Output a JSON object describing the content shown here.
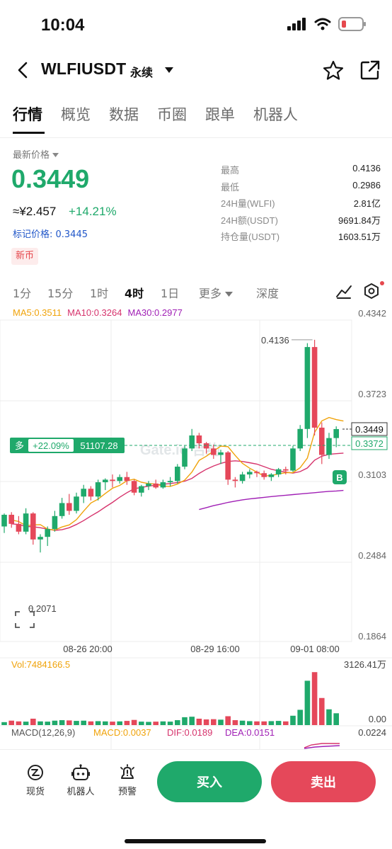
{
  "status": {
    "time": "10:04"
  },
  "header": {
    "symbol": "WLFIUSDT",
    "contract_type": "永续"
  },
  "tabs": [
    {
      "label": "行情",
      "active": true
    },
    {
      "label": "概览"
    },
    {
      "label": "数据"
    },
    {
      "label": "币圈"
    },
    {
      "label": "跟单"
    },
    {
      "label": "机器人"
    }
  ],
  "ticker": {
    "price_label": "最新价格",
    "last_price": "0.3449",
    "cny_price": "≈¥2.457",
    "change_pct": "+14.21%",
    "mark_price": "标记价格: 0.3445",
    "badge": "新币"
  },
  "stats": [
    {
      "label": "最高",
      "value": "0.4136"
    },
    {
      "label": "最低",
      "value": "0.2986"
    },
    {
      "label": "24H量(WLFI)",
      "value": "2.81亿"
    },
    {
      "label": "24H额(USDT)",
      "value": "9691.84万"
    },
    {
      "label": "持仓量(USDT)",
      "value": "1603.51万"
    }
  ],
  "timeframes": [
    {
      "label": "1分"
    },
    {
      "label": "15分"
    },
    {
      "label": "1时"
    },
    {
      "label": "4时",
      "active": true
    },
    {
      "label": "1日"
    },
    {
      "label": "更多"
    },
    {
      "label": "深度"
    }
  ],
  "ma_legend": {
    "ma5": "MA5:0.3511",
    "ma10": "MA10:0.3264",
    "ma30": "MA30:0.2977"
  },
  "colors": {
    "up": "#1fa96b",
    "down": "#e5485a",
    "ma5": "#f0a30a",
    "ma10": "#d6336c",
    "ma30": "#a01fb5",
    "accent_blue": "#2157c9"
  },
  "chart_data": {
    "type": "candlestick",
    "price_axis_labels": [
      "0.4342",
      "0.3723",
      "0.3103",
      "0.2484",
      "0.1864"
    ],
    "ylim": [
      0.1864,
      0.4342
    ],
    "x_tick_labels": [
      "08-26 20:00",
      "08-29 16:00",
      "09-01 08:00"
    ],
    "high_marker": "0.4136",
    "low_marker": "0.2071",
    "last_price_tag": "0.3449",
    "mark_price_tag": "0.3372",
    "position_tag": {
      "side": "多",
      "pnl": "+22.09%",
      "size": "51107.28"
    },
    "buy_marker": "B",
    "watermark": "Gate.io 合约",
    "candles": [
      [
        0.27,
        0.28,
        0.265,
        0.279
      ],
      [
        0.279,
        0.281,
        0.269,
        0.272
      ],
      [
        0.272,
        0.278,
        0.264,
        0.266
      ],
      [
        0.266,
        0.284,
        0.264,
        0.28
      ],
      [
        0.28,
        0.281,
        0.256,
        0.26
      ],
      [
        0.26,
        0.264,
        0.25,
        0.262
      ],
      [
        0.262,
        0.27,
        0.255,
        0.268
      ],
      [
        0.268,
        0.282,
        0.266,
        0.278
      ],
      [
        0.278,
        0.292,
        0.276,
        0.288
      ],
      [
        0.288,
        0.295,
        0.279,
        0.282
      ],
      [
        0.282,
        0.296,
        0.28,
        0.293
      ],
      [
        0.293,
        0.302,
        0.288,
        0.299
      ],
      [
        0.299,
        0.301,
        0.29,
        0.293
      ],
      [
        0.293,
        0.306,
        0.29,
        0.304
      ],
      [
        0.304,
        0.307,
        0.298,
        0.306
      ],
      [
        0.306,
        0.31,
        0.3,
        0.305
      ],
      [
        0.305,
        0.31,
        0.303,
        0.308
      ],
      [
        0.308,
        0.312,
        0.302,
        0.305
      ],
      [
        0.305,
        0.306,
        0.294,
        0.296
      ],
      [
        0.296,
        0.302,
        0.293,
        0.301
      ],
      [
        0.301,
        0.305,
        0.298,
        0.303
      ],
      [
        0.303,
        0.306,
        0.299,
        0.3
      ],
      [
        0.3,
        0.306,
        0.299,
        0.304
      ],
      [
        0.304,
        0.308,
        0.301,
        0.305
      ],
      [
        0.305,
        0.318,
        0.303,
        0.316
      ],
      [
        0.316,
        0.332,
        0.314,
        0.33
      ],
      [
        0.33,
        0.345,
        0.328,
        0.34
      ],
      [
        0.34,
        0.342,
        0.33,
        0.334
      ],
      [
        0.334,
        0.335,
        0.326,
        0.33
      ],
      [
        0.33,
        0.333,
        0.322,
        0.325
      ],
      [
        0.325,
        0.329,
        0.318,
        0.327
      ],
      [
        0.327,
        0.328,
        0.302,
        0.306
      ],
      [
        0.306,
        0.308,
        0.3,
        0.305
      ],
      [
        0.305,
        0.312,
        0.303,
        0.31
      ],
      [
        0.31,
        0.314,
        0.307,
        0.312
      ],
      [
        0.312,
        0.313,
        0.308,
        0.311
      ],
      [
        0.311,
        0.313,
        0.306,
        0.308
      ],
      [
        0.308,
        0.311,
        0.305,
        0.31
      ],
      [
        0.31,
        0.315,
        0.308,
        0.314
      ],
      [
        0.314,
        0.316,
        0.31,
        0.313
      ],
      [
        0.313,
        0.332,
        0.312,
        0.33
      ],
      [
        0.33,
        0.348,
        0.328,
        0.345
      ],
      [
        0.345,
        0.411,
        0.338,
        0.408
      ],
      [
        0.408,
        0.4136,
        0.34,
        0.346
      ],
      [
        0.346,
        0.35,
        0.318,
        0.325
      ],
      [
        0.325,
        0.342,
        0.322,
        0.338
      ],
      [
        0.338,
        0.347,
        0.331,
        0.3449
      ]
    ],
    "ma5": [
      0.275,
      0.2738,
      0.2706,
      0.2712,
      0.2714,
      0.268,
      0.2672,
      0.2696,
      0.2712,
      0.2752,
      0.2818,
      0.288,
      0.291,
      0.2954,
      0.2994,
      0.3016,
      0.3052,
      0.3064,
      0.304,
      0.303,
      0.3026,
      0.301,
      0.3008,
      0.3026,
      0.3056,
      0.3118,
      0.3208,
      0.324,
      0.328,
      0.3318,
      0.3314,
      0.3246,
      0.3186,
      0.3148,
      0.3118,
      0.3088,
      0.3092,
      0.3104,
      0.3114,
      0.3114,
      0.3152,
      0.3226,
      0.3424,
      0.3512,
      0.3538,
      0.3522,
      0.3511
    ],
    "ma10": [
      0.272,
      0.2715,
      0.27,
      0.2698,
      0.269,
      0.268,
      0.267,
      0.2675,
      0.269,
      0.2715,
      0.2745,
      0.278,
      0.2812,
      0.285,
      0.2885,
      0.2925,
      0.296,
      0.299,
      0.3,
      0.301,
      0.3018,
      0.3025,
      0.303,
      0.3038,
      0.3048,
      0.307,
      0.3108,
      0.314,
      0.3165,
      0.3185,
      0.32,
      0.3205,
      0.32,
      0.319,
      0.318,
      0.316,
      0.314,
      0.3128,
      0.3118,
      0.311,
      0.3122,
      0.315,
      0.321,
      0.324,
      0.3255,
      0.326,
      0.3264
    ],
    "ma30": [
      null,
      null,
      null,
      null,
      null,
      null,
      null,
      null,
      null,
      null,
      null,
      null,
      null,
      null,
      null,
      null,
      null,
      null,
      null,
      null,
      null,
      null,
      null,
      null,
      null,
      null,
      0.283,
      0.2845,
      0.286,
      0.2872,
      0.2885,
      0.2895,
      0.2905,
      0.2912,
      0.2918,
      0.2924,
      0.293,
      0.2935,
      0.294,
      0.2945,
      0.295,
      0.2955,
      0.296,
      0.2965,
      0.297,
      0.2973,
      0.2977
    ],
    "volume_label": "Vol:7484166.5",
    "volume_axis_max": "3126.41万",
    "volume_axis_min": "0.00",
    "volume": [
      120,
      180,
      150,
      140,
      260,
      150,
      140,
      180,
      200,
      190,
      170,
      180,
      150,
      160,
      150,
      140,
      150,
      170,
      210,
      140,
      130,
      140,
      150,
      140,
      200,
      320,
      340,
      260,
      230,
      240,
      220,
      360,
      200,
      180,
      160,
      150,
      150,
      160,
      170,
      150,
      380,
      620,
      1800,
      2150,
      1100,
      640,
      480
    ],
    "macd_legend": {
      "title": "MACD(12,26,9)",
      "macd": "MACD:0.0037",
      "dif": "DIF:0.0189",
      "dea": "DEA:0.0151"
    },
    "macd_axis": "0.0224"
  },
  "bottom_nav": [
    {
      "label": "现货",
      "icon": "spot-icon"
    },
    {
      "label": "机器人",
      "icon": "robot-icon"
    },
    {
      "label": "预警",
      "icon": "alert-icon"
    }
  ],
  "actions": {
    "buy": "买入",
    "sell": "卖出"
  }
}
